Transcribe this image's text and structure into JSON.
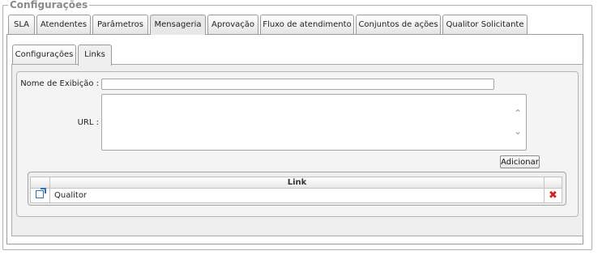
{
  "fieldset": {
    "legend": "Configurações"
  },
  "tabs": [
    {
      "label": "SLA"
    },
    {
      "label": "Atendentes"
    },
    {
      "label": "Parâmetros"
    },
    {
      "label": "Mensageria"
    },
    {
      "label": "Aprovação"
    },
    {
      "label": "Fluxo de atendimento"
    },
    {
      "label": "Conjuntos de ações"
    },
    {
      "label": "Qualitor Solicitante"
    }
  ],
  "active_tab": "Mensageria",
  "subtabs": [
    {
      "label": "Configurações"
    },
    {
      "label": "Links"
    }
  ],
  "active_subtab": "Links",
  "form": {
    "display_name_label": "Nome de Exibição :",
    "display_name_value": "",
    "url_label": "URL :",
    "url_value": "",
    "add_button": "Adicionar"
  },
  "links_table": {
    "column_header": "Link",
    "rows": [
      {
        "link": "Qualitor"
      }
    ]
  },
  "icons": {
    "edit": "edit-icon",
    "delete": "delete-icon"
  },
  "colors": {
    "delete": "#d42020",
    "edit": "#2f6fc0"
  }
}
